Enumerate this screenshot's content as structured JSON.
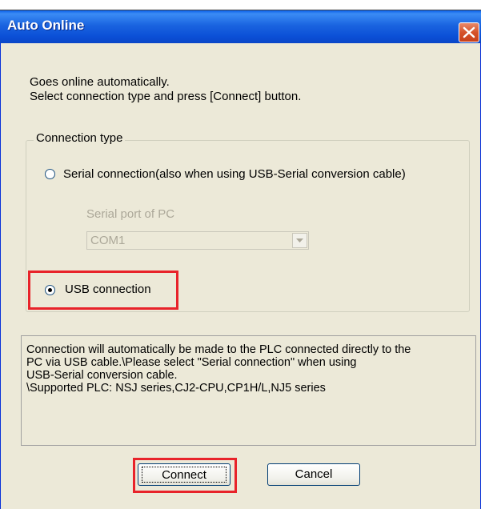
{
  "window": {
    "title": "Auto Online",
    "close_icon": "close-icon"
  },
  "description": {
    "line1": "Goes online automatically.",
    "line2": "Select connection type and press [Connect] button."
  },
  "connection_type": {
    "legend": "Connection type",
    "serial_label": "Serial connection(also when using USB-Serial conversion cable)",
    "serial_selected": false,
    "serial_port_label": "Serial port of PC",
    "serial_port_value": "COM1",
    "usb_label": "USB connection",
    "usb_selected": true
  },
  "info": {
    "lines": [
      "Connection will automatically be made to the PLC connected directly to the",
      "PC via USB cable.\\Please select \"Serial connection\" when using",
      "USB-Serial conversion cable.",
      "\\Supported PLC: NSJ series,CJ2-CPU,CP1H/L,NJ5 series"
    ]
  },
  "buttons": {
    "connect_label": "Connect",
    "cancel_label": "Cancel"
  },
  "colors": {
    "highlight": "#e8232a",
    "titlebar": "#0b4fd6",
    "dialog_bg": "#ece9d8"
  }
}
